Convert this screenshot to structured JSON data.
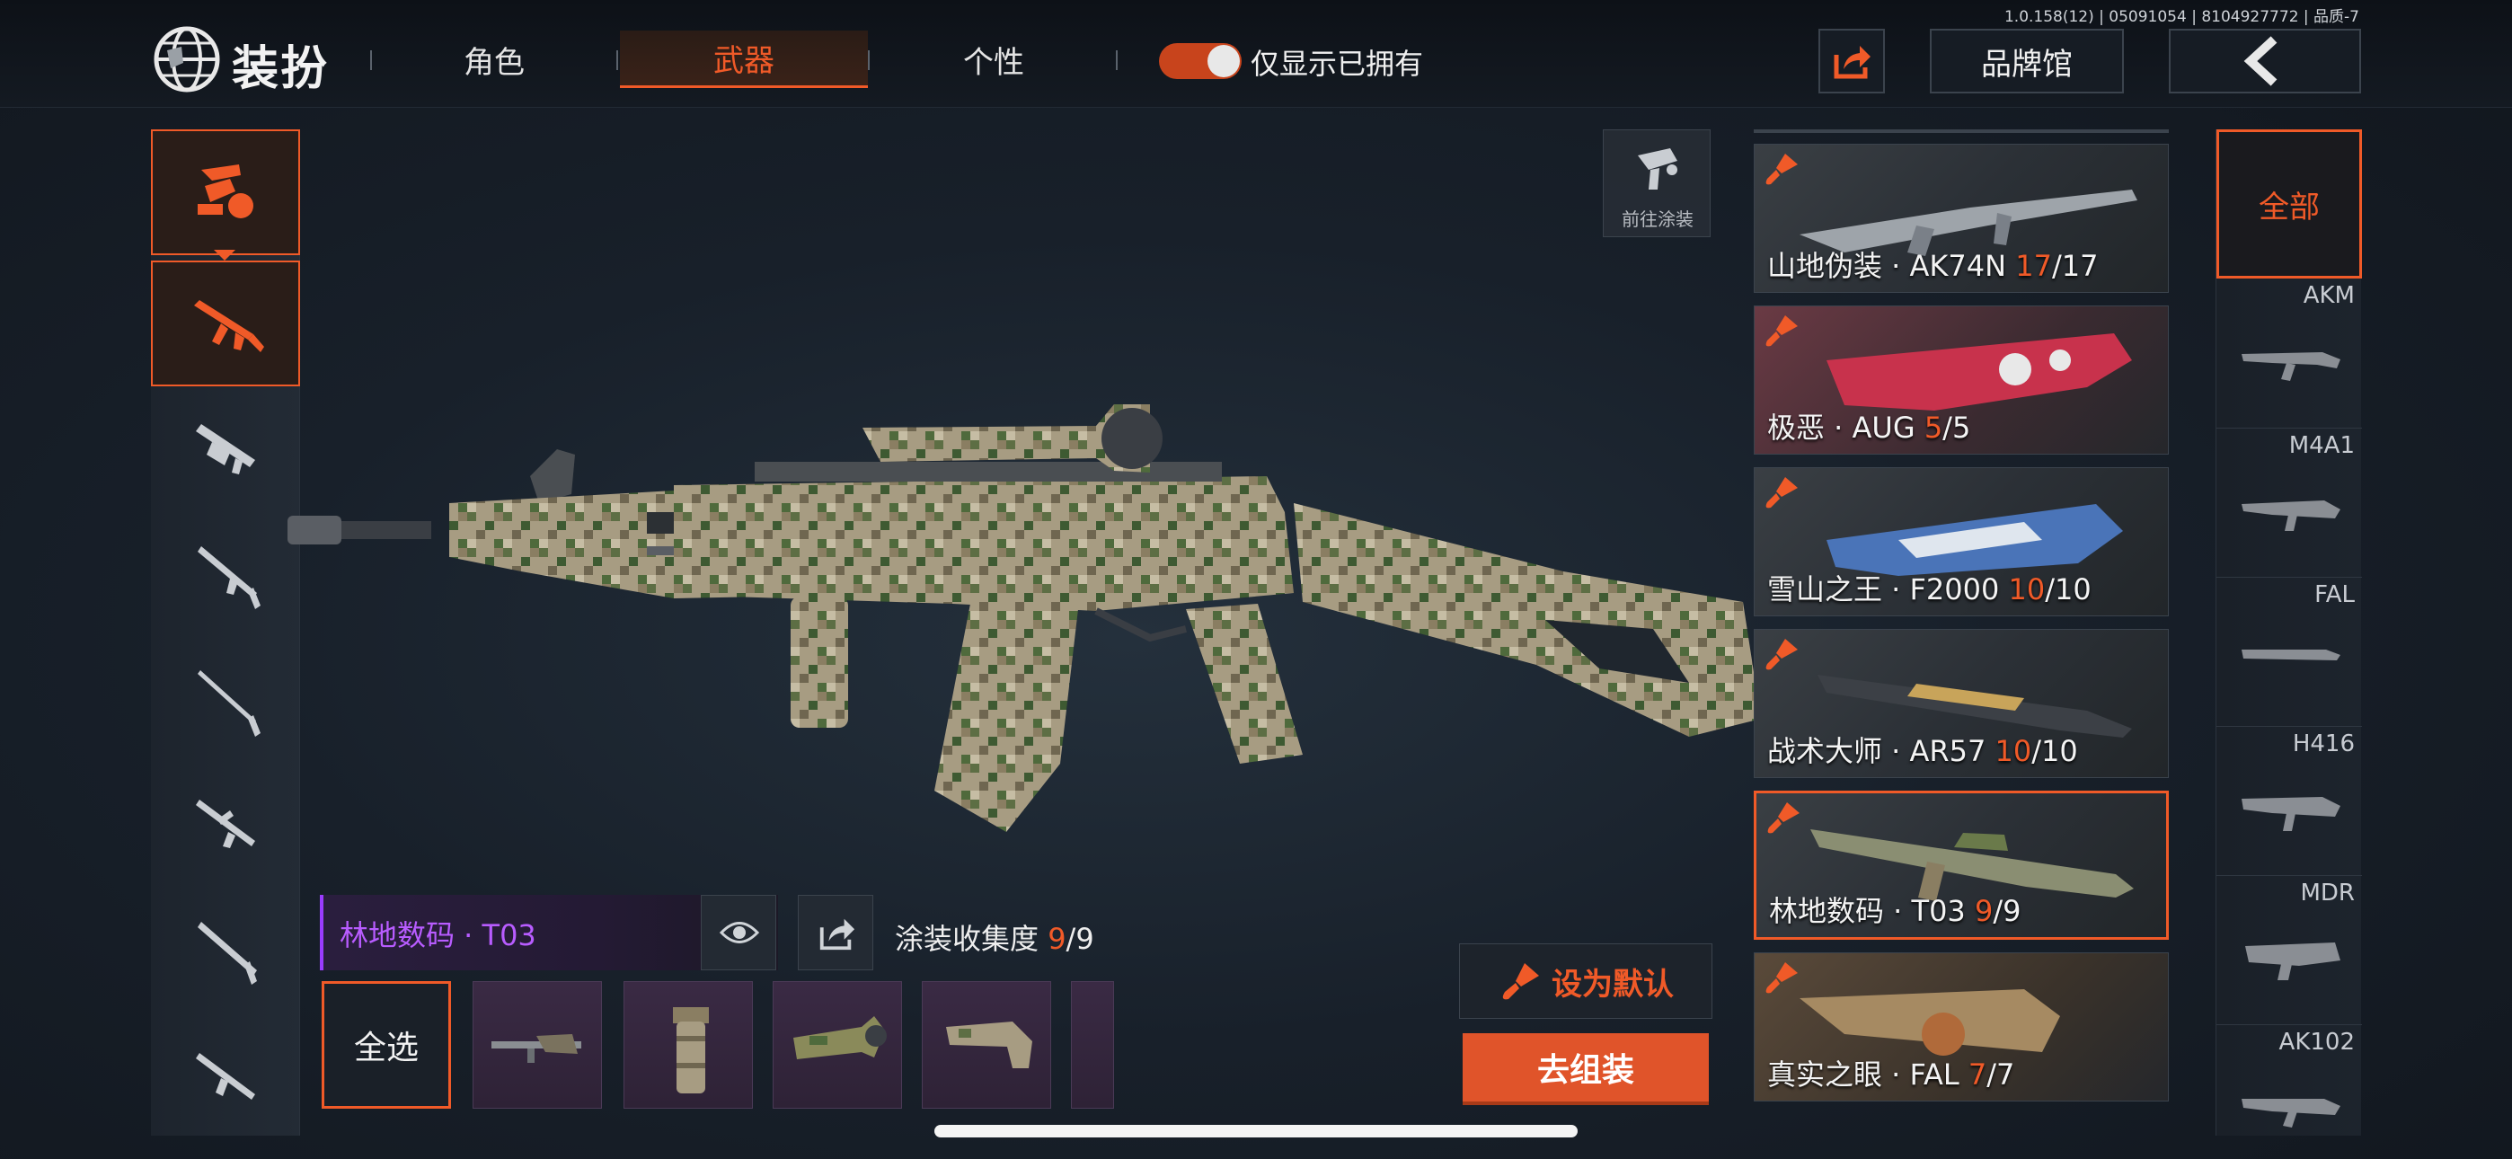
{
  "header": {
    "version": "1.0.158(12) | 05091054 | 8104927772 | 品质-7",
    "title": "装扮",
    "tabs": [
      {
        "label": "角色",
        "active": false
      },
      {
        "label": "武器",
        "active": true
      },
      {
        "label": "个性",
        "active": false
      }
    ],
    "owned_toggle": {
      "label": "仅显示已拥有",
      "on": true
    },
    "brand_button": "品牌馆",
    "share_icon": "share-icon",
    "back_icon": "back-arrow-icon"
  },
  "spray_goto_label": "前往涂装",
  "current_skin": {
    "name": "林地数码 · T03",
    "more": "···",
    "collection_label": "涂装收集度",
    "collected": "9",
    "total": "/9"
  },
  "parts": {
    "select_all": "全选",
    "items": [
      "muzzle-part-icon",
      "grip-part-icon",
      "scope-part-icon",
      "stock-part-icon",
      "magazine-part-icon"
    ]
  },
  "buttons": {
    "set_default": "设为默认",
    "assemble": "去组装"
  },
  "skins": [
    {
      "name": "山地伪装 · AK74N",
      "owned": "17",
      "total": "/17",
      "selected": false
    },
    {
      "name": "极恶 · AUG",
      "owned": "5",
      "total": "/5",
      "selected": false
    },
    {
      "name": "雪山之王 · F2000",
      "owned": "10",
      "total": "/10",
      "selected": false
    },
    {
      "name": "战术大师 · AR57",
      "owned": "10",
      "total": "/10",
      "selected": false
    },
    {
      "name": "林地数码 · T03",
      "owned": "9",
      "total": "/9",
      "selected": true
    },
    {
      "name": "真实之眼 · FAL",
      "owned": "7",
      "total": "/7",
      "selected": false
    }
  ],
  "gun_list": {
    "all_label": "全部",
    "guns": [
      "AKM",
      "M4A1",
      "FAL",
      "H416",
      "MDR",
      "AK102"
    ]
  },
  "colors": {
    "accent": "#f05a28",
    "skin_purple": "#b85cff",
    "background": "#18202a"
  }
}
